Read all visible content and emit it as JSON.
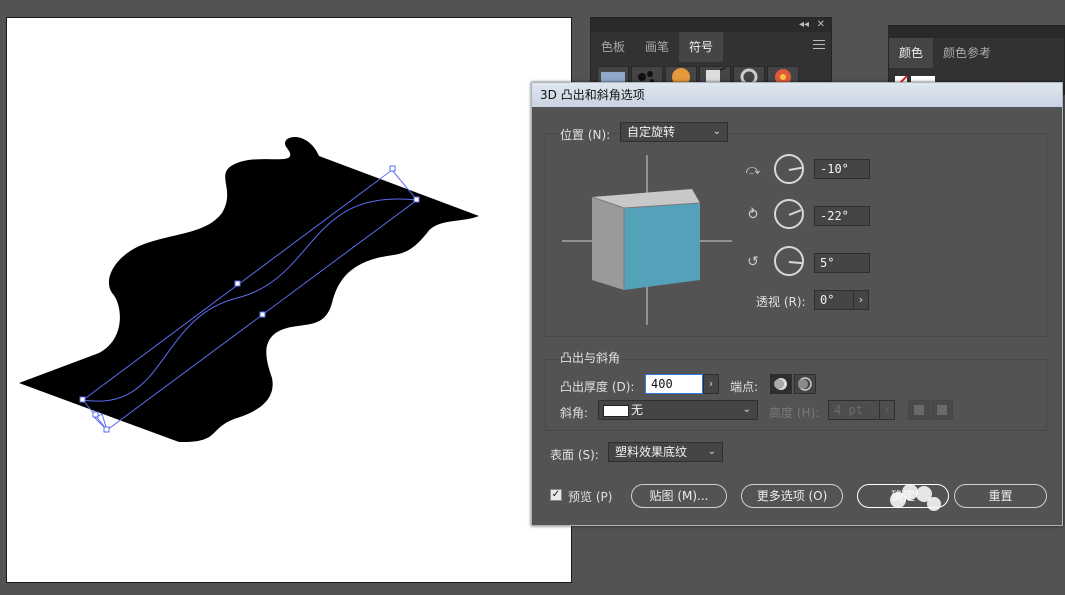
{
  "symbols_panel": {
    "tabs": [
      "色板",
      "画笔",
      "符号"
    ],
    "active_tab": "符号",
    "collapse_glyph": "◂◂",
    "close_glyph": "✕"
  },
  "color_panel": {
    "tabs": [
      "颜色",
      "颜色参考"
    ]
  },
  "dialog": {
    "title": "3D 凸出和斜角选项",
    "position": {
      "label": "位置 (N):",
      "value": "自定旋转"
    },
    "rotation": {
      "x": "-10°",
      "y": "-22°",
      "z": "5°"
    },
    "perspective": {
      "label": "透视 (R):",
      "value": "0°"
    },
    "extrude_section": "凸出与斜角",
    "extrude_depth": {
      "label": "凸出厚度 (D):",
      "value": "400"
    },
    "cap_label": "端点:",
    "bevel": {
      "label": "斜角:",
      "value": "无"
    },
    "height": {
      "label": "高度 (H):",
      "value": "4 pt"
    },
    "surface": {
      "label": "表面 (S):",
      "value": "塑料效果底纹"
    },
    "preview_label": "预览 (P)",
    "preview_checked": true,
    "map_button": "贴图 (M)...",
    "more_options_button": "更多选项 (O)",
    "ok_button": "确定",
    "reset_button": "重置"
  },
  "colors": {
    "cube_front": "#53a2b9",
    "cube_side": "#9a9a9a",
    "cube_top": "#c8c8c8",
    "path_stroke": "#5b6cf0",
    "title_bar": "#d6dde6"
  },
  "icons": [
    "x-rotation-icon",
    "y-rotation-icon",
    "z-rotation-icon",
    "chevron-down-icon",
    "chevron-right-icon",
    "menu-icon",
    "close-icon",
    "collapse-icon"
  ]
}
